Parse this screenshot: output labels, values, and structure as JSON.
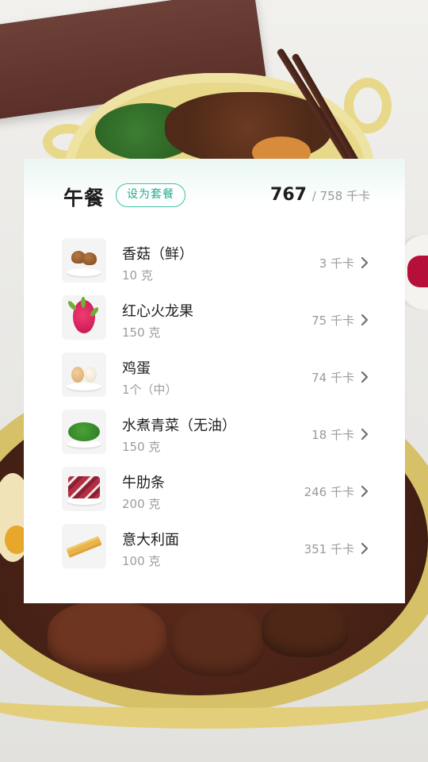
{
  "meal": {
    "title": "午餐",
    "preset_button": "设为套餐",
    "total_eaten": "767",
    "total_target": "/ 758 千卡"
  },
  "foods": [
    {
      "name": "香菇（鲜）",
      "amount": "10 克",
      "kcal": "3 千卡",
      "icon": "mushroom-icon"
    },
    {
      "name": "红心火龙果",
      "amount": "150 克",
      "kcal": "75 千卡",
      "icon": "dragon-fruit-icon"
    },
    {
      "name": "鸡蛋",
      "amount": "1个（中）",
      "kcal": "74 千卡",
      "icon": "egg-icon"
    },
    {
      "name": "水煮青菜（无油）",
      "amount": "150 克",
      "kcal": "18 千卡",
      "icon": "greens-icon"
    },
    {
      "name": "牛肋条",
      "amount": "200 克",
      "kcal": "246 千卡",
      "icon": "beef-icon"
    },
    {
      "name": "意大利面",
      "amount": "100 克",
      "kcal": "351 千卡",
      "icon": "pasta-icon"
    }
  ],
  "colors": {
    "accent": "#41bfa4",
    "text_primary": "#1d1d1d",
    "text_secondary": "#9a9a9a"
  }
}
